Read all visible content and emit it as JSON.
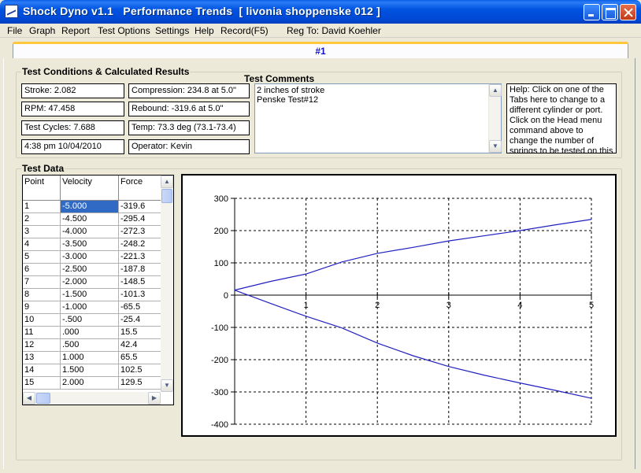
{
  "window": {
    "title": "Shock Dyno v1.1   Performance Trends  [ livonia shoppenske 012 ]",
    "icon": "chart-icon"
  },
  "menu": {
    "items": [
      "File",
      "Graph",
      "Report",
      "Test Options",
      "Settings",
      "Help",
      "Record(F5)"
    ],
    "registration": "Reg To: David Koehler"
  },
  "tab": {
    "label": "#1"
  },
  "conditions": {
    "title": "Test Conditions & Calculated Results",
    "stroke": "Stroke: 2.082",
    "rpm": "RPM: 47.458",
    "cycles": "Test Cycles: 7.688",
    "datetime": "4:38 pm  10/04/2010",
    "compression": "Compression: 234.8 at 5.0\"",
    "rebound": "Rebound: -319.6 at 5.0\"",
    "temp": "Temp: 73.3 deg   (73.1-73.4)",
    "operator": "Operator: Kevin"
  },
  "comments": {
    "title": "Test Comments",
    "lines": [
      "2 inches of stroke",
      "Penske Test#12"
    ]
  },
  "help": {
    "text": "Help:  Click on one of the Tabs here to change to a different cylinder or port. Click on the Head menu command above to change the number of springs to be tested on this head."
  },
  "test_data": {
    "title": "Test Data",
    "columns": [
      "Point",
      "Velocity",
      "Force"
    ],
    "rows": [
      [
        "1",
        "-5.000",
        "-319.6"
      ],
      [
        "2",
        "-4.500",
        "-295.4"
      ],
      [
        "3",
        "-4.000",
        "-272.3"
      ],
      [
        "4",
        "-3.500",
        "-248.2"
      ],
      [
        "5",
        "-3.000",
        "-221.3"
      ],
      [
        "6",
        "-2.500",
        "-187.8"
      ],
      [
        "7",
        "-2.000",
        "-148.5"
      ],
      [
        "8",
        "-1.500",
        "-101.3"
      ],
      [
        "9",
        "-1.000",
        "-65.5"
      ],
      [
        "10",
        "-.500",
        "-25.4"
      ],
      [
        "11",
        ".000",
        "15.5"
      ],
      [
        "12",
        ".500",
        "42.4"
      ],
      [
        "13",
        "1.000",
        "65.5"
      ],
      [
        "14",
        "1.500",
        "102.5"
      ],
      [
        "15",
        "2.000",
        "129.5"
      ]
    ],
    "selected_row": 0
  },
  "chart_data": {
    "type": "line",
    "title": "",
    "xlabel": "",
    "ylabel": "",
    "xlim": [
      0,
      5
    ],
    "ylim": [
      -400,
      300
    ],
    "x_ticks": [
      1,
      2,
      3,
      4,
      5
    ],
    "y_ticks": [
      300,
      200,
      100,
      0,
      -100,
      -200,
      -300,
      -400
    ],
    "grid": true,
    "line_color": "#2020c0",
    "series": [
      {
        "x": [
          0,
          0.5,
          1,
          1.5,
          2,
          2.5,
          3,
          3.5,
          4,
          4.5,
          5
        ],
        "y": [
          15.5,
          42.4,
          65.5,
          102.5,
          129.5,
          148,
          168,
          184,
          200,
          218,
          234.8
        ]
      },
      {
        "x": [
          0,
          0.5,
          1,
          1.5,
          2,
          2.5,
          3,
          3.5,
          4,
          4.5,
          5
        ],
        "y": [
          15.5,
          -25.4,
          -65.5,
          -101.3,
          -148.5,
          -187.8,
          -221.3,
          -248.2,
          -272.3,
          -295.4,
          -319.6
        ]
      }
    ]
  }
}
